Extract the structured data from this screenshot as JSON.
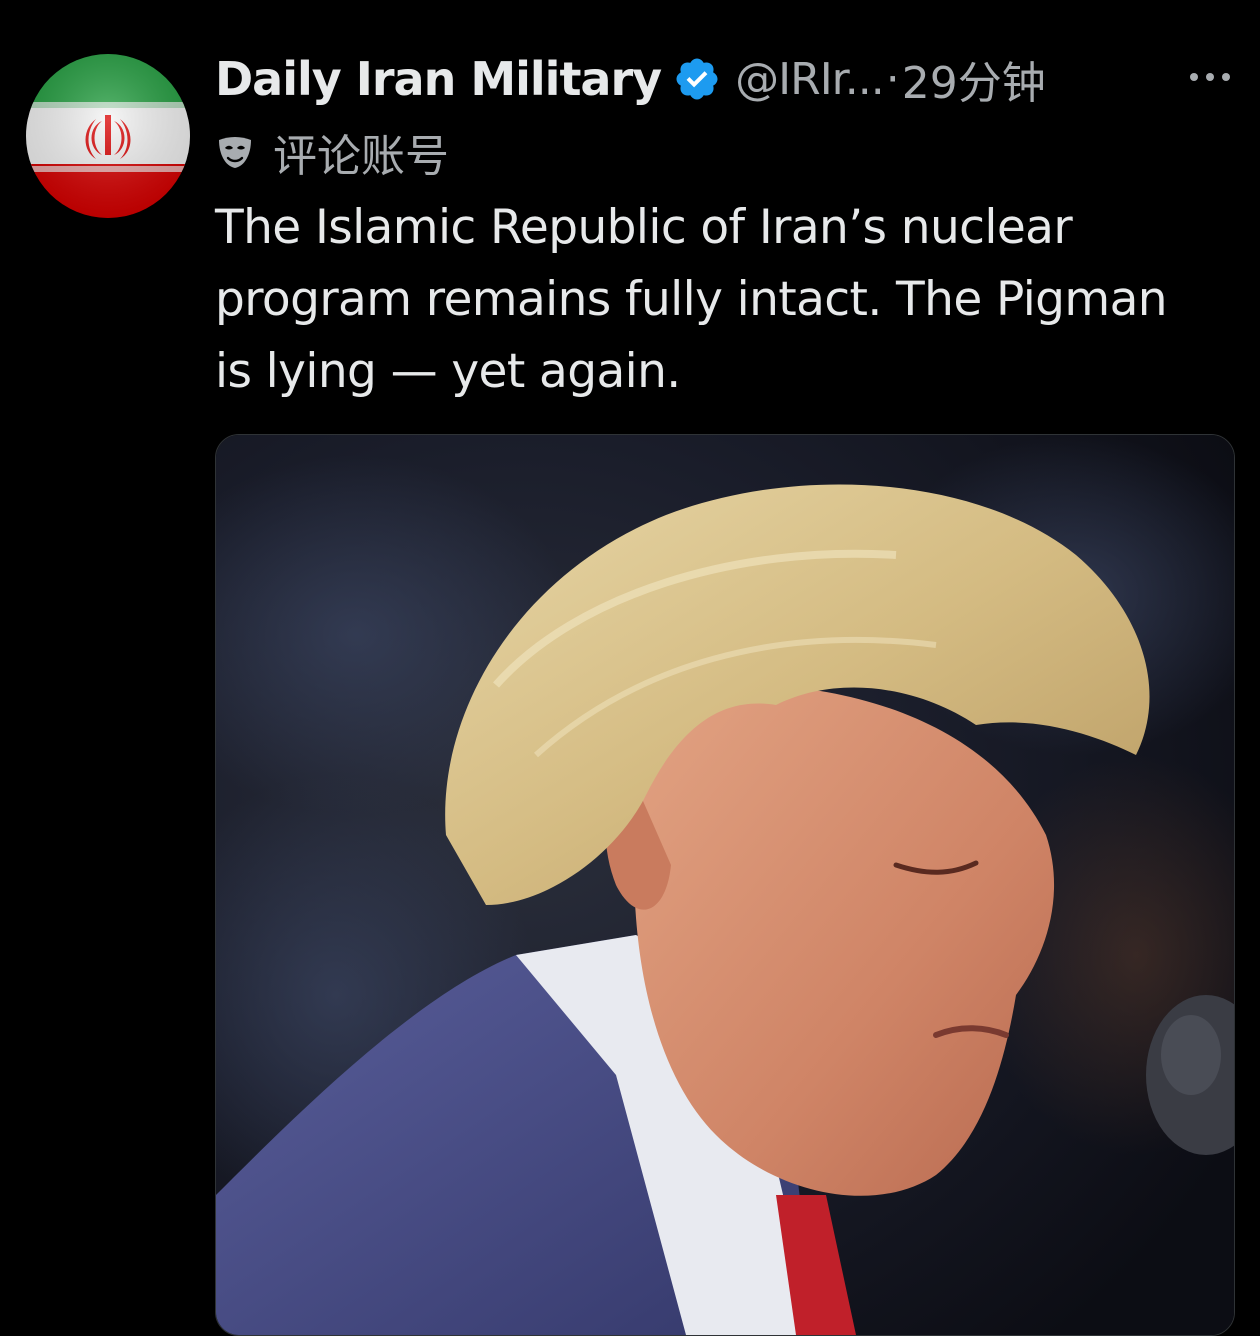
{
  "tweet": {
    "author": {
      "display_name": "Daily Iran Military",
      "handle": "@IRIr...",
      "verified_icon": "verified-badge-icon",
      "avatar_icon": "iran-flag-avatar"
    },
    "separator": "·",
    "time": "29分钟",
    "more_icon": "more-options-icon",
    "sublabel": {
      "icon": "mask-icon",
      "text": "评论账号"
    },
    "body_lines": [
      "The Islamic Republic of Iran’s nuclear",
      "program remains fully intact. The Pigman",
      "is lying — yet again."
    ],
    "media": {
      "type": "photo"
    }
  },
  "colors": {
    "background": "#000000",
    "text_primary": "#e7e9ea",
    "text_secondary": "#a8acb0",
    "verified_blue": "#1d9bf0",
    "flag_green": "#239f40",
    "flag_white": "#ffffff",
    "flag_red": "#da0000"
  }
}
